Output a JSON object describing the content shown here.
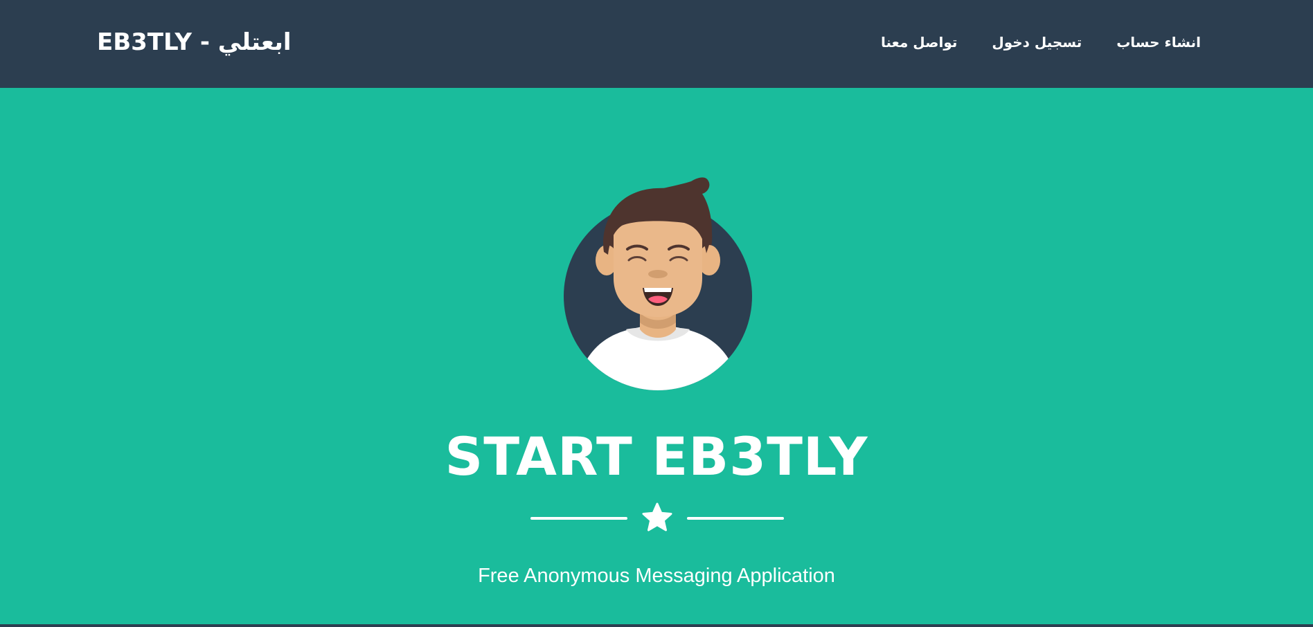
{
  "navbar": {
    "brand": "EB3TLY - ابعتلي",
    "links": [
      {
        "label": "انشاء حساب"
      },
      {
        "label": "تسجيل دخول"
      },
      {
        "label": "تواصل معنا"
      }
    ]
  },
  "hero": {
    "title": "START EB3TLY",
    "subtitle": "Free Anonymous Messaging Application",
    "avatar_icon": "avatar-icon",
    "divider_icon": "star-icon"
  },
  "colors": {
    "navbar_bg": "#2c3e50",
    "hero_bg": "#1abc9c",
    "text": "#ffffff"
  }
}
